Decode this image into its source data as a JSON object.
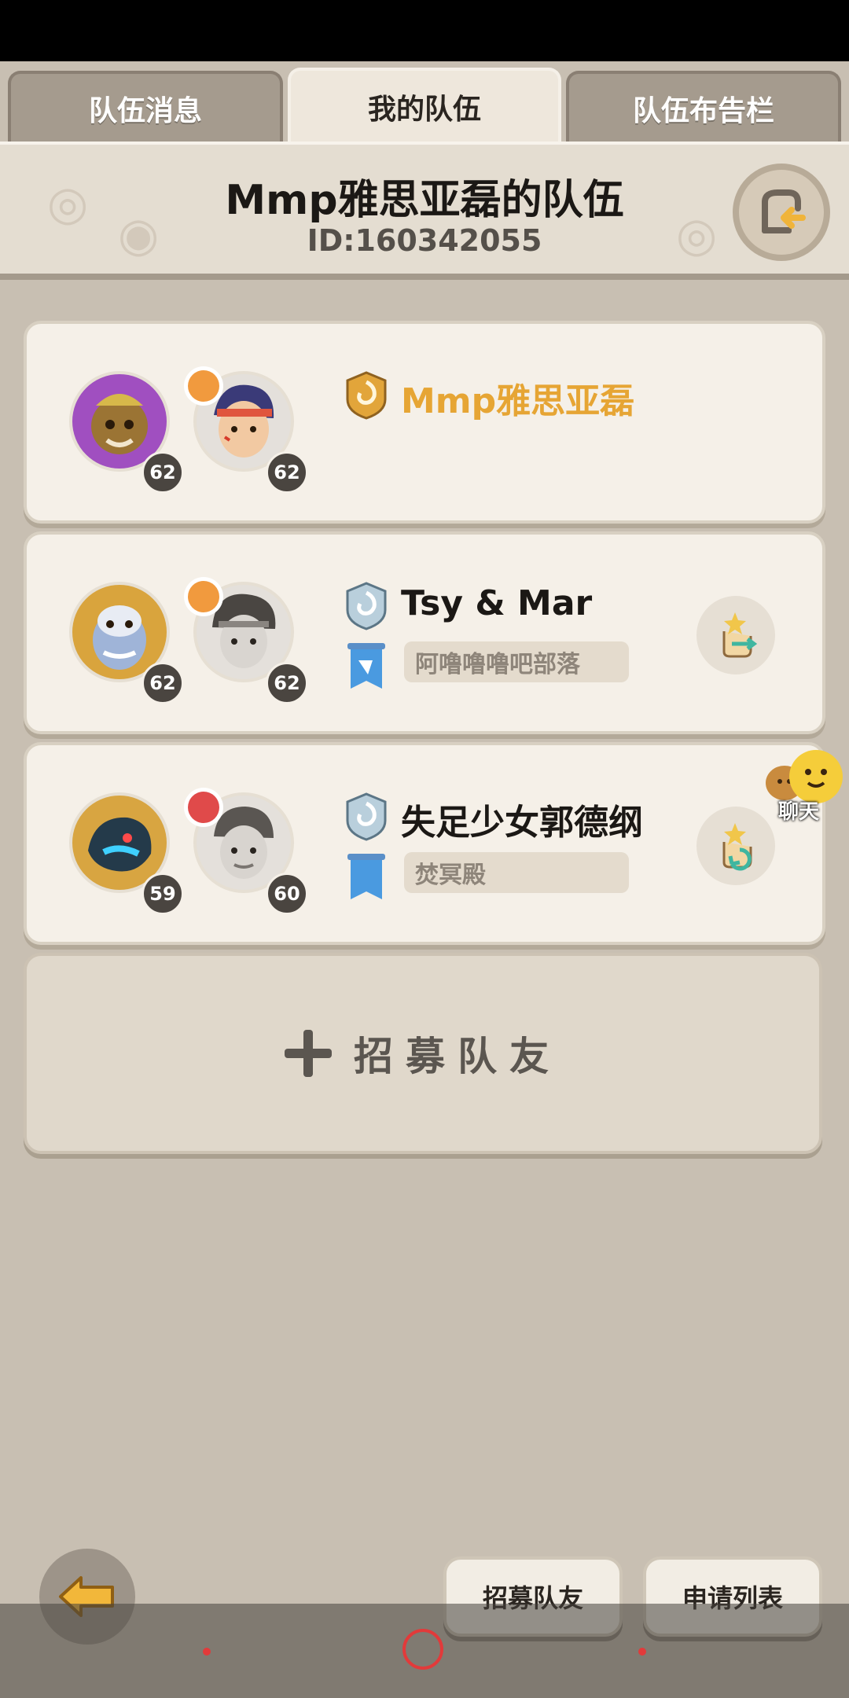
{
  "tabs": [
    {
      "label": "队伍消息"
    },
    {
      "label": "我的队伍",
      "active": true
    },
    {
      "label": "队伍布告栏"
    }
  ],
  "team": {
    "title": "Mmp雅思亚磊的队伍",
    "id_text": "ID:160342055"
  },
  "members": [
    {
      "name": "Mmp雅思亚磊",
      "pet_level": "62",
      "hero_level": "62",
      "guild": "",
      "leader": true
    },
    {
      "name": "Tsy & Mar",
      "pet_level": "62",
      "hero_level": "62",
      "guild": "阿噜噜噜吧部落"
    },
    {
      "name": "失足少女郭德纲",
      "pet_level": "59",
      "hero_level": "60",
      "guild": "焚冥殿"
    }
  ],
  "recruit_panel": {
    "label": "招募队友"
  },
  "chat": {
    "label": "聊天"
  },
  "bottom": {
    "recruit_label": "招募队友",
    "apply_list_label": "申请列表"
  },
  "colors": {
    "leader_name": "#e6a534",
    "accent_red": "#e23a3a"
  }
}
